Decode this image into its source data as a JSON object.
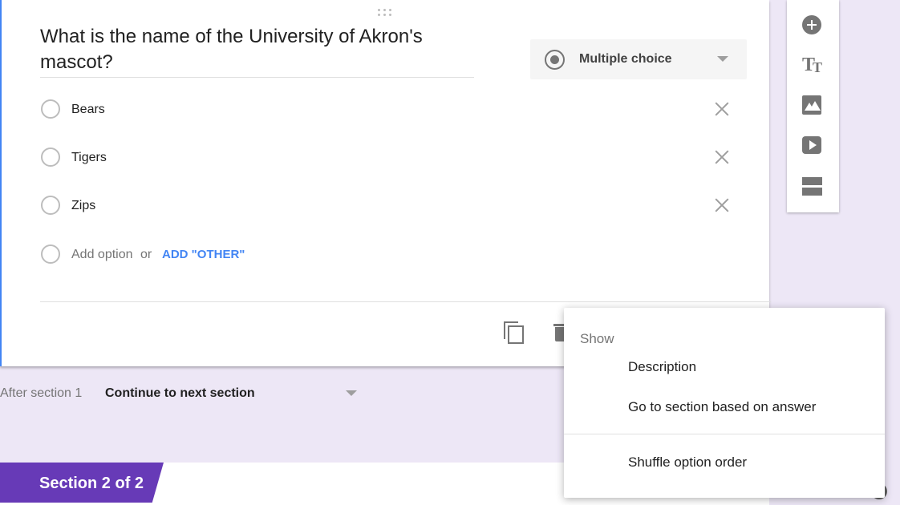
{
  "question": {
    "title": "What is the name of the University of Akron's mascot?",
    "type_label": "Multiple choice",
    "options": [
      {
        "label": "Bears"
      },
      {
        "label": "Tigers"
      },
      {
        "label": "Zips"
      }
    ],
    "add_option_label": "Add option",
    "or_label": "or",
    "add_other_label": "ADD \"OTHER\""
  },
  "after_section": {
    "label": "After section 1",
    "value": "Continue to next section"
  },
  "section2": {
    "label": "Section 2 of 2"
  },
  "menu": {
    "header": "Show",
    "items": [
      "Description",
      "Go to section based on answer",
      "Shuffle option order"
    ]
  },
  "toolbar": {
    "icons": [
      "add-circle-icon",
      "title-icon",
      "image-icon",
      "video-icon",
      "section-icon"
    ]
  },
  "colors": {
    "accent": "#4285f4",
    "section_tab": "#673ab7",
    "background": "#ede7f6"
  }
}
